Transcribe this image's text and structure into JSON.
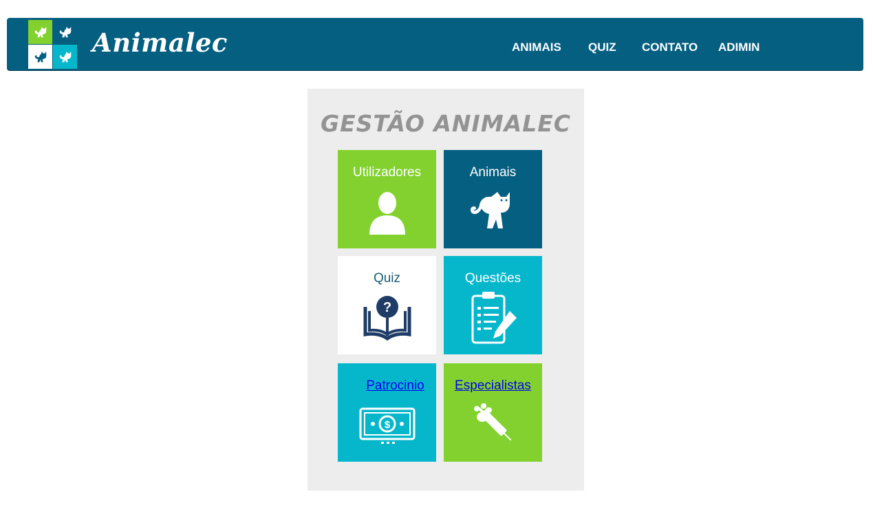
{
  "brand": {
    "name": "Animalec"
  },
  "nav": {
    "items": [
      "ANIMAIS",
      "QUIZ",
      "CONTATO",
      "ADIMIN"
    ]
  },
  "panel": {
    "title": "GESTÃO ANIMALEC"
  },
  "tiles": [
    {
      "label": "Utilizadores",
      "icon": "user-icon",
      "color": "#82d12e"
    },
    {
      "label": "Animais",
      "icon": "cat-icon",
      "color": "#045f80"
    },
    {
      "label": "Quiz",
      "icon": "quiz-book-icon",
      "color": "#ffffff"
    },
    {
      "label": "Questões",
      "icon": "clipboard-icon",
      "color": "#06b7cc"
    },
    {
      "label": "Patrocinio",
      "icon": "money-icon",
      "color": "#06b7cc"
    },
    {
      "label": "Especialistas",
      "icon": "syringe-paw-icon",
      "color": "#82d12e"
    }
  ]
}
